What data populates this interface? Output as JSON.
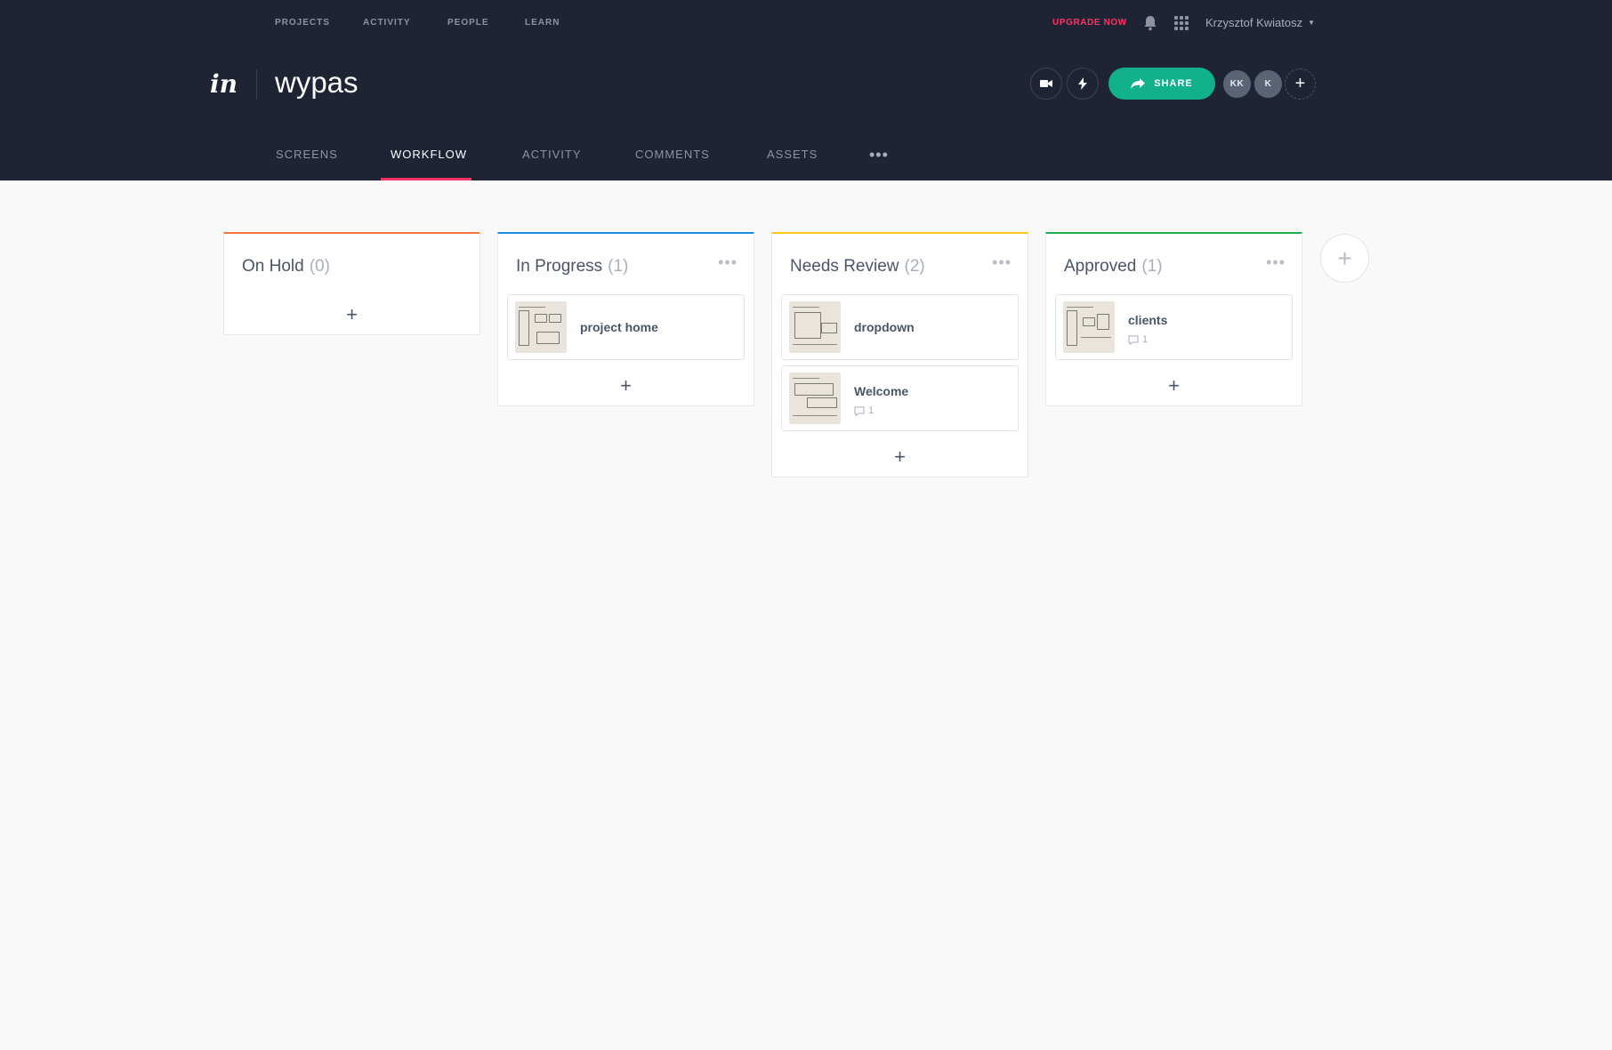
{
  "topnav": {
    "items": [
      "PROJECTS",
      "ACTIVITY",
      "PEOPLE",
      "LEARN"
    ],
    "upgrade_label": "UPGRADE NOW",
    "user_name": "Krzysztof Kwiatosz"
  },
  "project": {
    "logo": "in",
    "title": "wypas",
    "share_label": "SHARE",
    "avatars": [
      "KK",
      "K"
    ],
    "add_person_label": "+"
  },
  "subnav": {
    "items": [
      "SCREENS",
      "WORKFLOW",
      "ACTIVITY",
      "COMMENTS",
      "ASSETS"
    ],
    "active": "WORKFLOW",
    "more_label": "•••"
  },
  "board": {
    "columns": [
      {
        "title": "On Hold",
        "count": "(0)",
        "color": "#f5793a",
        "cards": []
      },
      {
        "title": "In Progress",
        "count": "(1)",
        "color": "#1f8ce6",
        "cards": [
          {
            "name": "project home",
            "comments": null
          }
        ]
      },
      {
        "title": "Needs Review",
        "count": "(2)",
        "color": "#f7c624",
        "cards": [
          {
            "name": "dropdown",
            "comments": null
          },
          {
            "name": "Welcome",
            "comments": "1"
          }
        ]
      },
      {
        "title": "Approved",
        "count": "(1)",
        "color": "#1fad4f",
        "cards": [
          {
            "name": "clients",
            "comments": "1"
          }
        ]
      }
    ],
    "add_card_label": "+",
    "column_menu_label": "•••",
    "add_column_label": "+"
  },
  "colors": {
    "header_bg": "#1e2433",
    "accent_pink": "#ff3366",
    "share_green": "#13b08c",
    "page_bg": "#f9f9fa"
  }
}
